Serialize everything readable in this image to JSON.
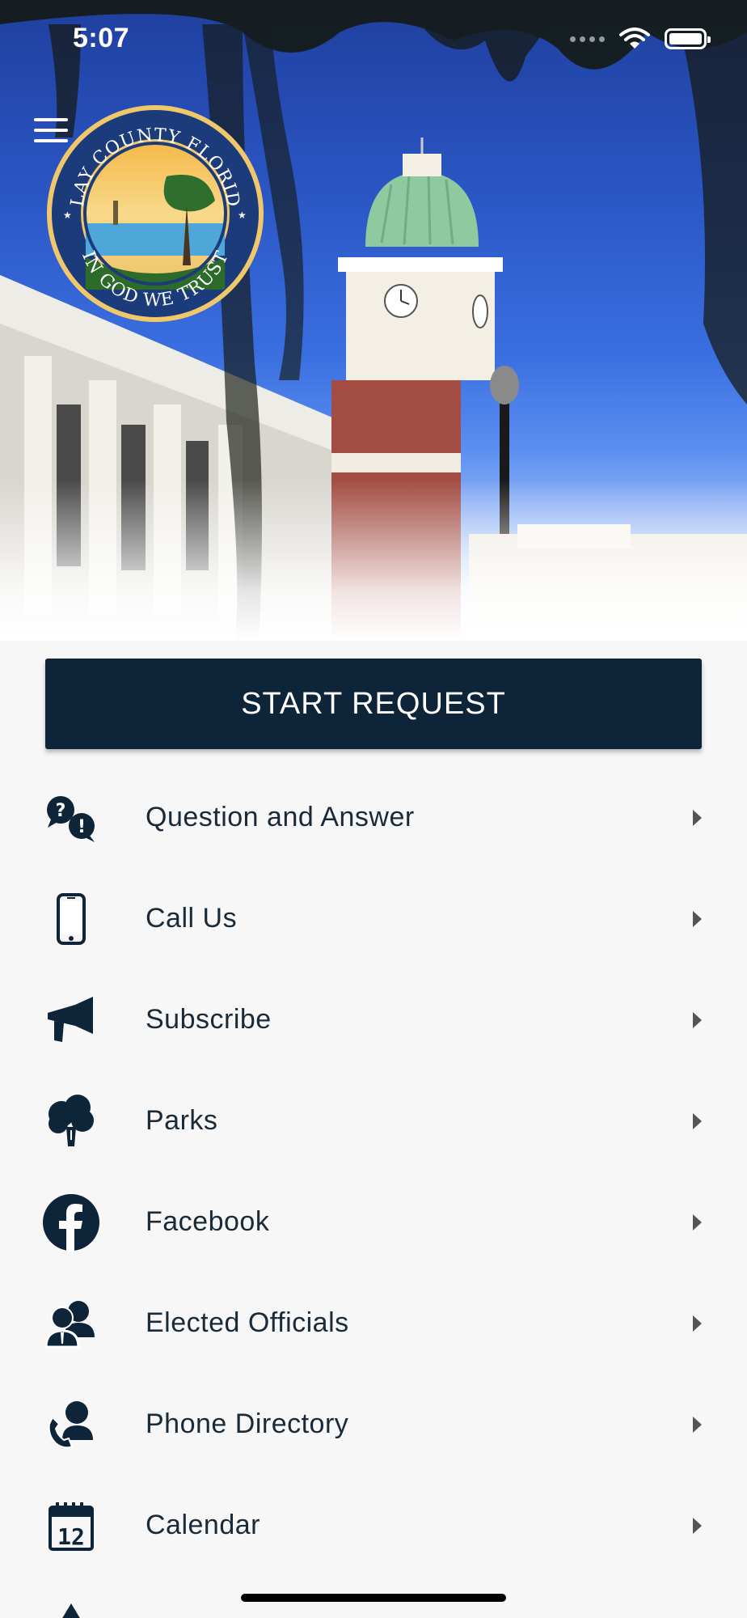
{
  "status_bar": {
    "time": "5:07"
  },
  "header": {
    "seal": {
      "top_text": "CLAY COUNTY FLORIDA",
      "bottom_text": "IN GOD WE TRUST"
    }
  },
  "main": {
    "start_request_label": "START REQUEST",
    "menu": [
      {
        "label": "Question and Answer",
        "icon": "question-answer-icon"
      },
      {
        "label": "Call Us",
        "icon": "phone-icon"
      },
      {
        "label": "Subscribe",
        "icon": "megaphone-icon"
      },
      {
        "label": "Parks",
        "icon": "tree-icon"
      },
      {
        "label": "Facebook",
        "icon": "facebook-icon"
      },
      {
        "label": "Elected Officials",
        "icon": "officials-icon"
      },
      {
        "label": "Phone Directory",
        "icon": "phone-directory-icon"
      },
      {
        "label": "Calendar",
        "icon": "calendar-icon"
      }
    ]
  },
  "colors": {
    "primary": "#0e2438",
    "background": "#f7f7f7",
    "text": "#1a2a38"
  }
}
